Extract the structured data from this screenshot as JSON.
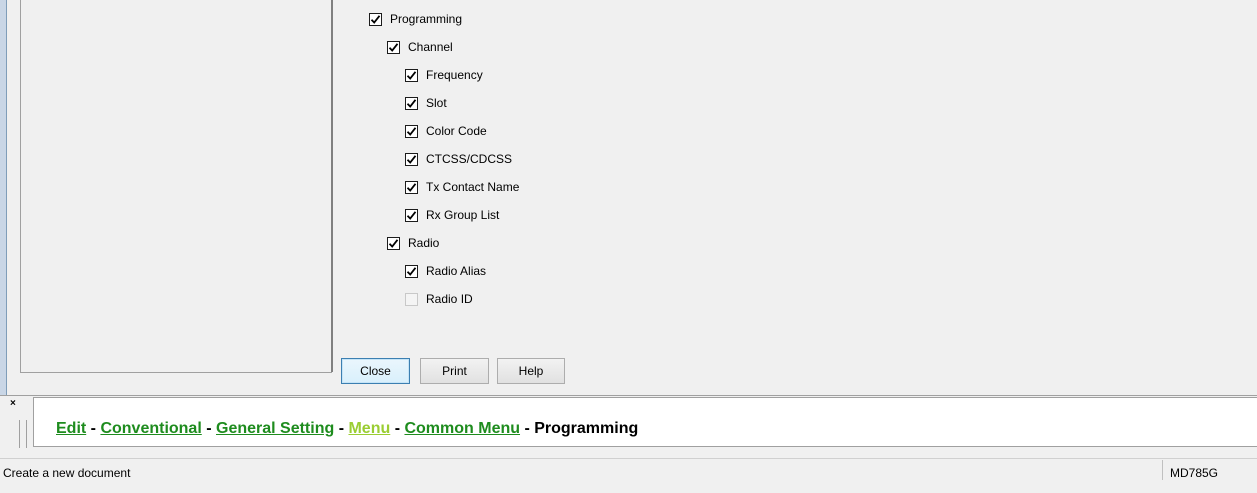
{
  "tree": {
    "items": [
      {
        "label": "Programming",
        "checked": true,
        "level": 0
      },
      {
        "label": "Channel",
        "checked": true,
        "level": 1
      },
      {
        "label": "Frequency",
        "checked": true,
        "level": 2
      },
      {
        "label": "Slot",
        "checked": true,
        "level": 2
      },
      {
        "label": "Color Code",
        "checked": true,
        "level": 2
      },
      {
        "label": "CTCSS/CDCSS",
        "checked": true,
        "level": 2
      },
      {
        "label": "Tx Contact Name",
        "checked": true,
        "level": 2
      },
      {
        "label": "Rx Group List",
        "checked": true,
        "level": 2
      },
      {
        "label": "Radio",
        "checked": true,
        "level": 1
      },
      {
        "label": "Radio Alias",
        "checked": true,
        "level": 2
      },
      {
        "label": "Radio ID",
        "checked": false,
        "level": 2
      }
    ]
  },
  "buttons": {
    "close": "Close",
    "print": "Print",
    "help": "Help"
  },
  "breadcrumb": {
    "close_glyph": "×",
    "items": [
      {
        "label": "Edit",
        "link": true
      },
      {
        "label": "Conventional",
        "link": true
      },
      {
        "label": "General Setting",
        "link": true
      },
      {
        "label": "Menu",
        "link": true,
        "visited": true
      },
      {
        "label": "Common Menu",
        "link": true
      },
      {
        "label": "Programming",
        "link": false
      }
    ],
    "separator": " - "
  },
  "status": {
    "message": "Create a new document",
    "model": "MD785G"
  },
  "colors": {
    "link": "#1e8c1e",
    "visited_link": "#9acd32"
  }
}
